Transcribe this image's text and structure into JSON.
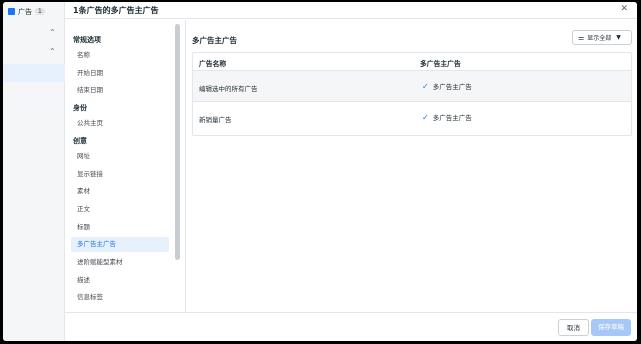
{
  "rail": {
    "tab_label": "广告",
    "tab_badge": "1"
  },
  "dialog": {
    "title": "1条广告的多广告主广告",
    "close_glyph": "✕"
  },
  "sidenav": {
    "sections": [
      {
        "label": "常规选项",
        "items": [
          "名称",
          "开始日期",
          "结束日期"
        ]
      },
      {
        "label": "身份",
        "items": [
          "公共主页"
        ]
      },
      {
        "label": "创意",
        "items": [
          "网址",
          "显示链接",
          "素材",
          "正文",
          "标题",
          "多广告主广告",
          "进阶赋能型素材",
          "描述",
          "信息标签"
        ]
      }
    ],
    "active_item": "多广告主广告"
  },
  "content": {
    "section_title": "多广告主广告",
    "show_all_label": "显示全部",
    "table": {
      "columns": [
        "广告名称",
        "多广告主广告"
      ],
      "rows": [
        {
          "name": "编辑选中的所有广告",
          "value": "多广告主广告"
        },
        {
          "name": "新销量广告",
          "value": "多广告主广告"
        }
      ]
    }
  },
  "footer": {
    "cancel_label": "取消",
    "save_label": "保存草稿"
  },
  "colors": {
    "accent": "#1877f2",
    "save_disabled": "#a7c8f7"
  }
}
